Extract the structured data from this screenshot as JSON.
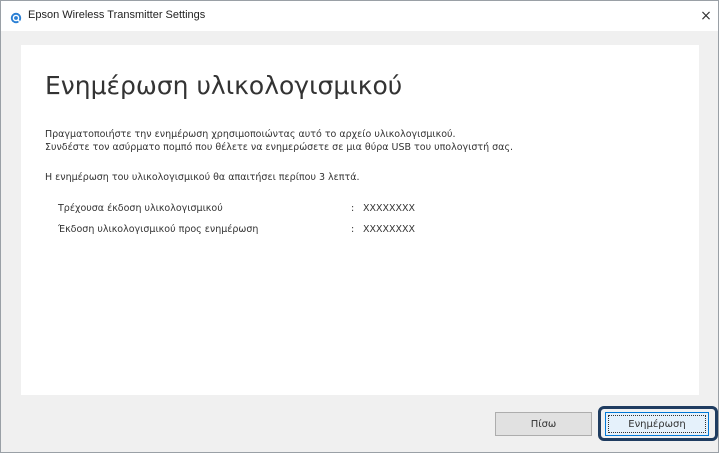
{
  "window": {
    "title": "Epson Wireless Transmitter Settings",
    "close_glyph": "×"
  },
  "main": {
    "heading": "Ενημέρωση υλικολογισμικού",
    "instruction_line1": "Πραγματοποιήστε την ενημέρωση χρησιμοποιώντας αυτό το αρχείο υλικολογισμικού.",
    "instruction_line2": "Συνδέστε τον ασύρματο πομπό που θέλετε να ενημερώσετε σε μια θύρα USB του υπολογιστή σας.",
    "duration_note": "Η ενημέρωση του υλικολογισμικού θα απαιτήσει περίπου 3 λεπτά.",
    "info_rows": [
      {
        "label": "Τρέχουσα έκδοση υλικολογισμικού",
        "separator": ":",
        "value": "XXXXXXXX"
      },
      {
        "label": "Έκδοση υλικολογισμικού προς ενημέρωση",
        "separator": ":",
        "value": "XXXXXXXX"
      }
    ]
  },
  "buttons": {
    "back_label": "Πίσω",
    "update_label": "Ενημέρωση"
  },
  "colors": {
    "highlight_border": "#1f3c60",
    "title_icon": "#2a7fd4"
  }
}
